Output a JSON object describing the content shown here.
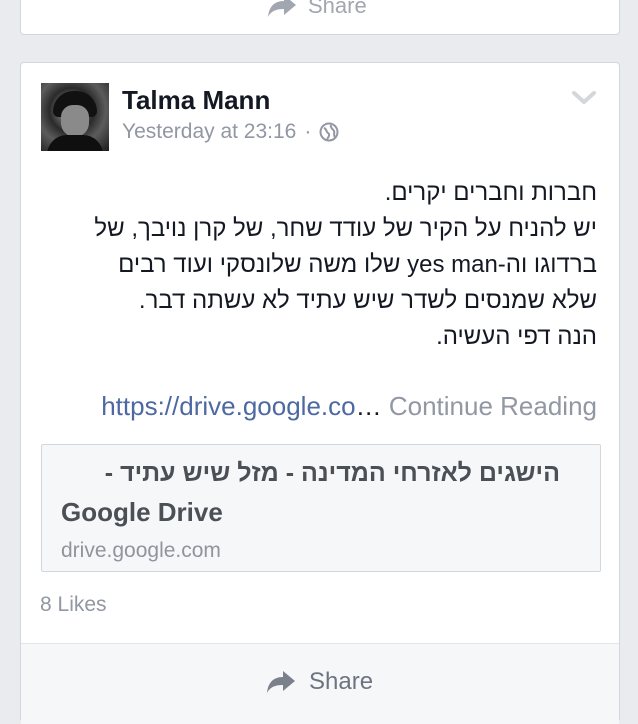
{
  "previous_post": {
    "share_label": "Share"
  },
  "post": {
    "author": "Talma Mann",
    "timestamp": "Yesterday at 23:16",
    "separator": "·",
    "privacy_icon": "globe-icon",
    "menu_icon": "chevron-down-icon",
    "text_lines": [
      "חברות וחברים יקרים.",
      "יש להניח על הקיר של עודד שחר, של קרן נויבך, של",
      "ברדוגו וה-yes man שלו משה שלונסקי ועוד רבים",
      "שלא שמנסים לשדר שיש עתיד לא עשתה דבר.",
      "הנה דפי העשיה."
    ],
    "link_text": "https://drive.google.co",
    "ellipsis": "…",
    "continue_reading": "Continue Reading",
    "link_preview": {
      "title_hebrew": "הישגים לאזרחי המדינה - מזל שיש עתיד -",
      "title_english": "Google Drive",
      "domain": "drive.google.com"
    },
    "likes": "8 Likes",
    "share_label": "Share"
  },
  "colors": {
    "background": "#e9ebee",
    "card": "#ffffff",
    "link": "#4e69a2",
    "muted": "#9197a3",
    "text": "#141823"
  }
}
